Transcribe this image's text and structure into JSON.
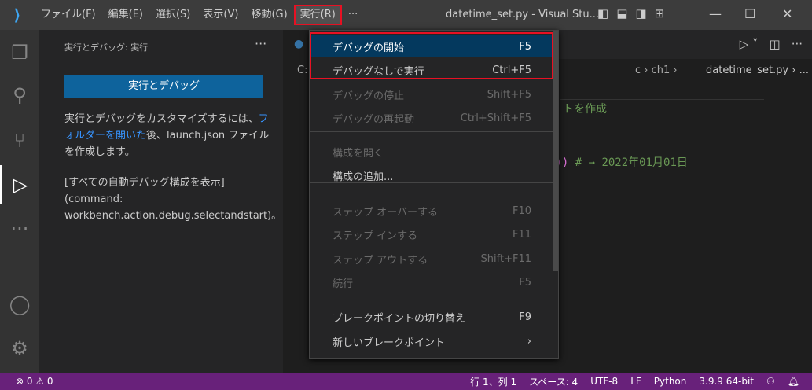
{
  "titlebar": {
    "menus": [
      "ファイル(F)",
      "編集(E)",
      "選択(S)",
      "表示(V)",
      "移動(G)",
      "実行(R)",
      "···"
    ],
    "title": "datetime_set.py - Visual Stu..."
  },
  "sidebar": {
    "title": "実行とデバッグ: 実行",
    "more": "···",
    "run_button": "実行とデバッグ",
    "desc_pre": "実行とデバッグをカスタマイズするには、",
    "desc_link": "フォルダーを開いた",
    "desc_post": "後、launch.json ファイルを作成します。",
    "hint1": "[すべての自動デバッグ構成を表示]",
    "hint2": "(command:",
    "hint3": "workbench.action.debug.selectandstart)。"
  },
  "editor": {
    "crumb_prefix": "C:",
    "crumb": "c › ch1 › ",
    "crumb_file": "datetime_set.py › ...",
    "line1": "トを作成",
    "line2_paren": "'))",
    "line2": " # → 2022年01月01日"
  },
  "run_menu": [
    {
      "label": "デバッグの開始",
      "shortcut": "F5",
      "state": "selected"
    },
    {
      "label": "デバッグなしで実行",
      "shortcut": "Ctrl+F5",
      "state": "enabled"
    },
    {
      "label": "デバッグの停止",
      "shortcut": "Shift+F5",
      "state": "disabled"
    },
    {
      "label": "デバッグの再起動",
      "shortcut": "Ctrl+Shift+F5",
      "state": "disabled"
    },
    {
      "label": "構成を開く",
      "shortcut": "",
      "state": "disabled"
    },
    {
      "label": "構成の追加...",
      "shortcut": "",
      "state": "enabled"
    },
    {
      "label": "ステップ オーバーする",
      "shortcut": "F10",
      "state": "disabled"
    },
    {
      "label": "ステップ インする",
      "shortcut": "F11",
      "state": "disabled"
    },
    {
      "label": "ステップ アウトする",
      "shortcut": "Shift+F11",
      "state": "disabled"
    },
    {
      "label": "続行",
      "shortcut": "F5",
      "state": "disabled"
    },
    {
      "label": "ブレークポイントの切り替え",
      "shortcut": "F9",
      "state": "enabled"
    },
    {
      "label": "新しいブレークポイント",
      "shortcut": "›",
      "state": "enabled"
    }
  ],
  "status": {
    "errors": "0",
    "warnings": "0",
    "position": "行 1、列 1",
    "spaces": "スペース: 4",
    "encoding": "UTF-8",
    "eol": "LF",
    "language": "Python",
    "interpreter": "3.9.9 64-bit"
  },
  "colors": {
    "accent": "#0e639c",
    "statusbar": "#68217a",
    "highlight": "#e81123"
  }
}
